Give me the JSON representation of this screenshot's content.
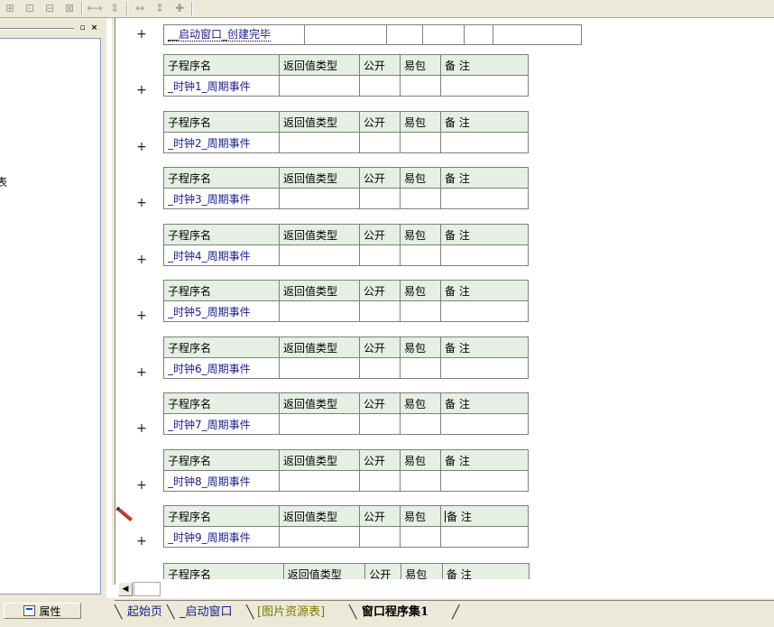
{
  "toolbar": {
    "icons": [
      "align-left-icon",
      "align-center-icon",
      "align-top-icon",
      "align-right-icon",
      "same-width-icon",
      "same-height-icon",
      "h-space-icon",
      "v-space-icon",
      "center-icon"
    ]
  },
  "left_panel": {
    "minimize_glyph": "▫",
    "close_glyph": "×",
    "clipped_text": "表",
    "properties_tab": "属性"
  },
  "first_row": {
    "name": "__启动窗口_创建完毕"
  },
  "headers": {
    "sub_name": "子程序名",
    "return_type": "返回值类型",
    "public": "公开",
    "easy_pkg": "易包",
    "remark": "备 注"
  },
  "subroutines": [
    {
      "name": "_时钟1_周期事件"
    },
    {
      "name": "_时钟2_周期事件"
    },
    {
      "name": "_时钟3_周期事件"
    },
    {
      "name": "_时钟4_周期事件"
    },
    {
      "name": "_时钟5_周期事件"
    },
    {
      "name": "_时钟6_周期事件"
    },
    {
      "name": "_时钟7_周期事件"
    },
    {
      "name": "_时钟8_周期事件"
    },
    {
      "name": "_时钟9_周期事件"
    }
  ],
  "gutter_glyph": "+",
  "doc_tabs": {
    "start": "起始页",
    "window": "_启动窗口",
    "images": "[图片资源表]",
    "active": "窗口程序集1"
  }
}
